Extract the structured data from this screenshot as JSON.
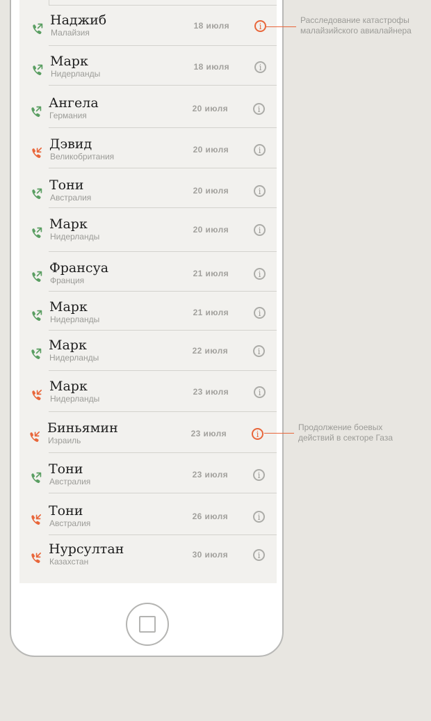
{
  "colors": {
    "outgoing": "#5a9e62",
    "missed": "#e8663a",
    "accent": "#e8663a"
  },
  "calls": [
    {
      "name": "Наджиб",
      "country": "Малайзия",
      "date": "18 июля",
      "type": "outgoing",
      "highlighted": true
    },
    {
      "name": "Марк",
      "country": "Нидерланды",
      "date": "18 июля",
      "type": "outgoing",
      "highlighted": false
    },
    {
      "name": "Ангела",
      "country": "Германия",
      "date": "20 июля",
      "type": "outgoing",
      "highlighted": false
    },
    {
      "name": "Дэвид",
      "country": "Великобритания",
      "date": "20 июля",
      "type": "missed",
      "highlighted": false
    },
    {
      "name": "Тони",
      "country": "Австралия",
      "date": "20 июля",
      "type": "outgoing",
      "highlighted": false
    },
    {
      "name": "Марк",
      "country": "Нидерланды",
      "date": "20 июля",
      "type": "outgoing",
      "highlighted": false
    },
    {
      "name": "Франсуа",
      "country": "Франция",
      "date": "21 июля",
      "type": "outgoing",
      "highlighted": false
    },
    {
      "name": "Марк",
      "country": "Нидерланды",
      "date": "21 июля",
      "type": "outgoing",
      "highlighted": false
    },
    {
      "name": "Марк",
      "country": "Нидерланды",
      "date": "22 июля",
      "type": "outgoing",
      "highlighted": false
    },
    {
      "name": "Марк",
      "country": "Нидерланды",
      "date": "23 июля",
      "type": "missed",
      "highlighted": false
    },
    {
      "name": "Биньямин",
      "country": "Израиль",
      "date": "23 июля",
      "type": "missed",
      "highlighted": true
    },
    {
      "name": "Тони",
      "country": "Австралия",
      "date": "23 июля",
      "type": "outgoing",
      "highlighted": false
    },
    {
      "name": "Тони",
      "country": "Австралия",
      "date": "26 июля",
      "type": "missed",
      "highlighted": false
    },
    {
      "name": "Нурсултан",
      "country": "Казахстан",
      "date": "30 июля",
      "type": "missed",
      "highlighted": false
    }
  ],
  "annotations": [
    {
      "row": 0,
      "lines": [
        "Расследование катастрофы",
        "малайзийского авиалайнера"
      ]
    },
    {
      "row": 10,
      "lines": [
        "Продолжение боевых",
        "действий в секторе Газа"
      ]
    }
  ]
}
